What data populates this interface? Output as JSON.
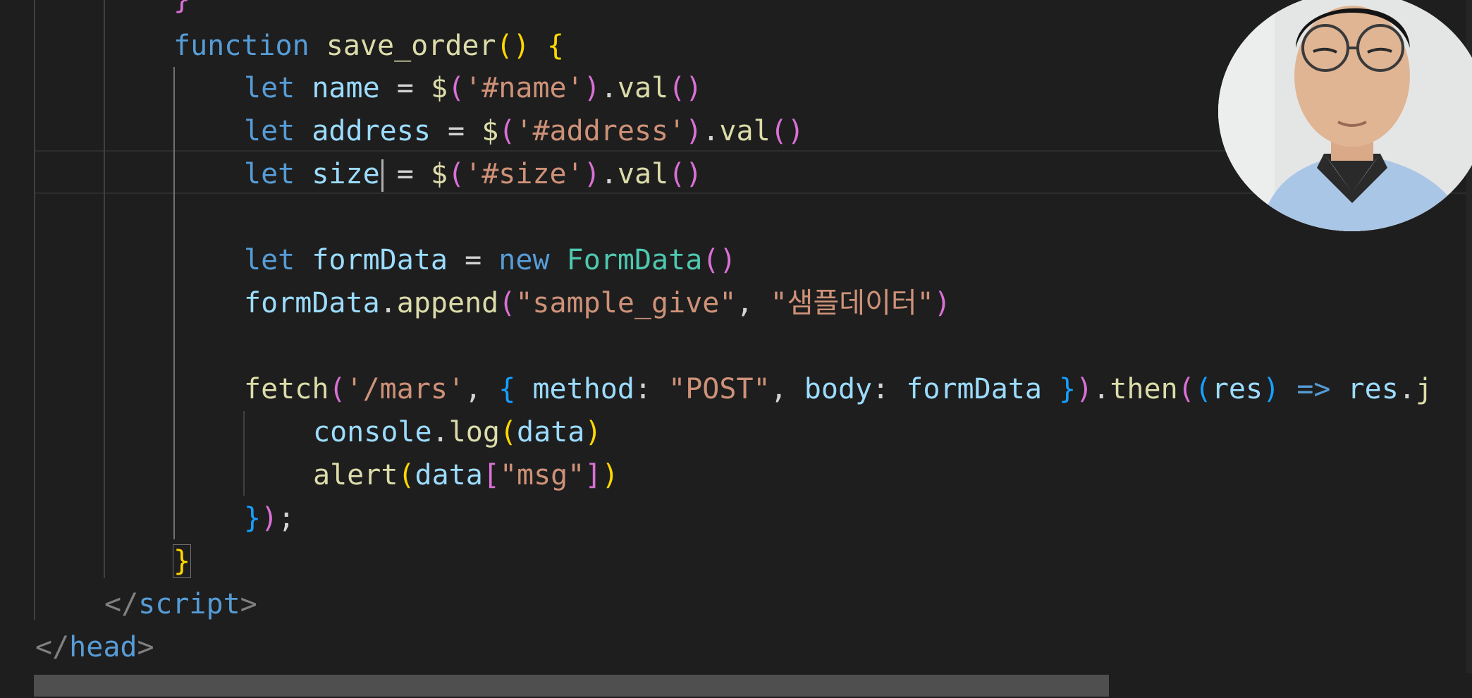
{
  "editor": {
    "language": "html",
    "colors": {
      "background": "#1e1e1e",
      "keyword": "#569cd6",
      "function": "#dcdcaa",
      "variable": "#9cdcfe",
      "string": "#ce9178",
      "class": "#4ec9b0",
      "bracket_level1": "#ffd700",
      "bracket_level2": "#da70d6",
      "bracket_level3": "#179fff"
    },
    "lines": {
      "func_keyword": "function",
      "func_name": "save_order",
      "let": "let",
      "name_var": "name",
      "name_selector": "'#name'",
      "address_var": "address",
      "address_selector": "'#address'",
      "size_var": "size",
      "size_selector": "'#size'",
      "val_method": "val",
      "formdata_var": "formData",
      "new_keyword": "new",
      "formdata_class": "FormData",
      "append_method": "append",
      "append_key": "\"sample_give\"",
      "append_value": "\"샘플데이터\"",
      "fetch_fn": "fetch",
      "fetch_url": "'/mars'",
      "method_key": "method",
      "method_value": "\"POST\"",
      "body_key": "body",
      "then_method": "then",
      "res_param": "res",
      "res_ref": "res",
      "res_tail": "j",
      "console_obj": "console",
      "log_method": "log",
      "data_var": "data",
      "alert_fn": "alert",
      "msg_key": "\"msg\"",
      "script_close": "script",
      "head_close": "head"
    }
  },
  "webcam": {
    "icon": "presenter-webcam-icon"
  }
}
